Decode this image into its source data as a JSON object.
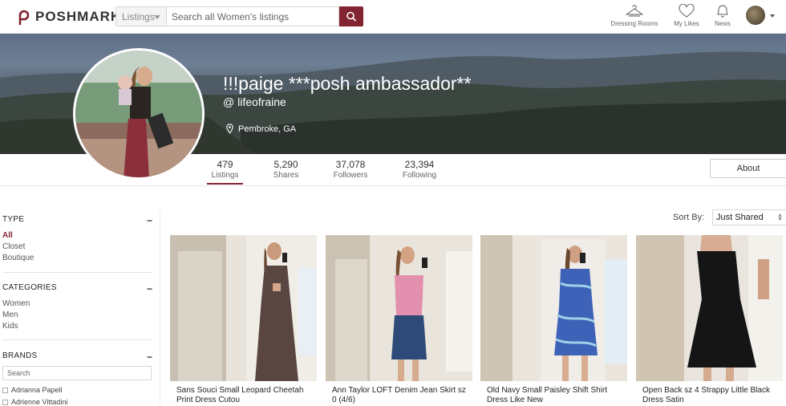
{
  "header": {
    "logo_text": "POSHMARK",
    "search_scope": "Listings",
    "search_placeholder": "Search all Women's listings",
    "nav": [
      {
        "label": "Dressing Rooms",
        "icon": "hanger-icon"
      },
      {
        "label": "My Likes",
        "icon": "heart-icon"
      },
      {
        "label": "News",
        "icon": "bell-icon"
      }
    ]
  },
  "profile": {
    "name": "!!!paige ***posh ambassador**",
    "handle": "@ lifeofraine",
    "location": "Pembroke, GA"
  },
  "stats": [
    {
      "value": "479",
      "label": "Listings"
    },
    {
      "value": "5,290",
      "label": "Shares"
    },
    {
      "value": "37,078",
      "label": "Followers"
    },
    {
      "value": "23,394",
      "label": "Following"
    }
  ],
  "about_label": "About",
  "filters": {
    "type": {
      "title": "TYPE",
      "toggle": "−",
      "options": [
        "All",
        "Closet",
        "Boutique"
      ]
    },
    "categories": {
      "title": "CATEGORIES",
      "toggle": "−",
      "options": [
        "Women",
        "Men",
        "Kids"
      ]
    },
    "brands": {
      "title": "BRANDS",
      "toggle": "−",
      "search_placeholder": "Search",
      "options": [
        "Adrianna Papell",
        "Adrienne Vittadini"
      ]
    }
  },
  "sort": {
    "label": "Sort By:",
    "value": "Just Shared"
  },
  "listings": [
    {
      "title": "Sans Souci Small Leopard Cheetah Print Dress Cutou",
      "dress_color": "#5a4640"
    },
    {
      "title": "Ann Taylor LOFT Denim Jean Skirt sz 0 (4/6)",
      "dress_color": "#2e4a78"
    },
    {
      "title": "Old Navy Small Paisley Shift Shirt Dress Like New",
      "dress_color": "#3e62b8"
    },
    {
      "title": "Open Back sz 4 Strappy Little Black Dress Satin",
      "dress_color": "#151515"
    }
  ],
  "colors": {
    "brand": "#822432"
  }
}
